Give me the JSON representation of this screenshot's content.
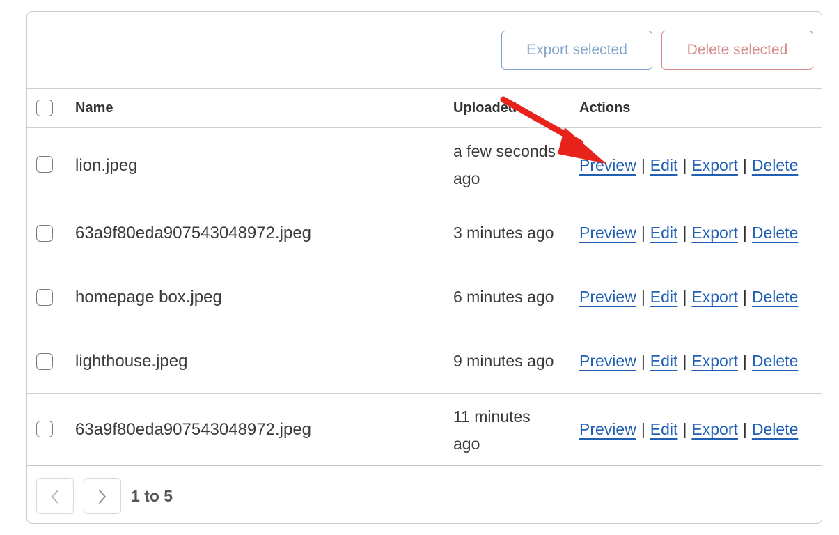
{
  "toolbar": {
    "export_label": "Export selected",
    "delete_label": "Delete selected"
  },
  "table": {
    "columns": {
      "name": "Name",
      "uploaded": "Uploaded",
      "actions": "Actions"
    },
    "rows": [
      {
        "name": "lion.jpeg",
        "uploaded": "a few seconds ago"
      },
      {
        "name": "63a9f80eda907543048972.jpeg",
        "uploaded": "3 minutes ago"
      },
      {
        "name": "homepage box.jpeg",
        "uploaded": "6 minutes ago"
      },
      {
        "name": "lighthouse.jpeg",
        "uploaded": "9 minutes ago"
      },
      {
        "name": "63a9f80eda907543048972.jpeg",
        "uploaded": "11 minutes ago"
      }
    ],
    "action_labels": {
      "preview": "Preview",
      "edit": "Edit",
      "export": "Export",
      "delete": "Delete",
      "separator": "|"
    }
  },
  "pagination": {
    "range_label": "1 to 5",
    "prev_icon": "chevron-left-icon",
    "next_icon": "chevron-right-icon"
  },
  "colors": {
    "link": "#1f5fb4",
    "export_border": "#7fa3cf",
    "delete_border": "#d48c8c",
    "annotation_arrow": "#e8231b"
  }
}
